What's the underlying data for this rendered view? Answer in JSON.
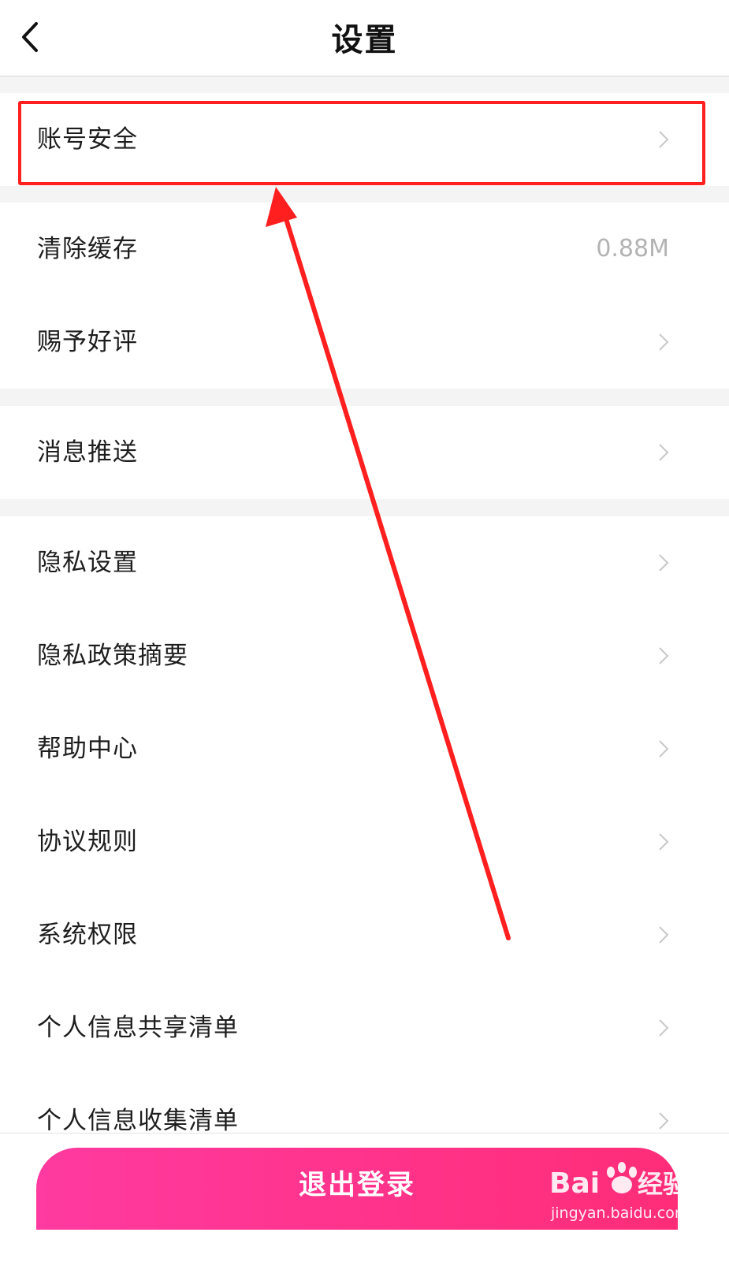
{
  "header": {
    "title": "设置",
    "back_icon": "chevron-left-icon"
  },
  "groups": [
    {
      "items": [
        {
          "label": "账号安全",
          "has_arrow": true
        }
      ]
    },
    {
      "items": [
        {
          "label": "清除缓存",
          "value": "0.88M",
          "has_arrow": false
        },
        {
          "label": "赐予好评",
          "has_arrow": true
        }
      ]
    },
    {
      "items": [
        {
          "label": "消息推送",
          "has_arrow": true
        }
      ]
    },
    {
      "items": [
        {
          "label": "隐私设置",
          "has_arrow": true
        },
        {
          "label": "隐私政策摘要",
          "has_arrow": true
        },
        {
          "label": "帮助中心",
          "has_arrow": true
        },
        {
          "label": "协议规则",
          "has_arrow": true
        },
        {
          "label": "系统权限",
          "has_arrow": true
        },
        {
          "label": "个人信息共享清单",
          "has_arrow": true
        },
        {
          "label": "个人信息收集清单",
          "has_arrow": true
        }
      ]
    }
  ],
  "footer": {
    "logout_label": "退出登录"
  },
  "annotation": {
    "highlight_color": "#ff1f1f"
  },
  "watermark": {
    "logo": "Bai du 经验",
    "url": "jingyan.baidu.com"
  },
  "colors": {
    "logout_gradient_start": "#ff3aa0",
    "logout_gradient_end": "#ff2d78"
  }
}
